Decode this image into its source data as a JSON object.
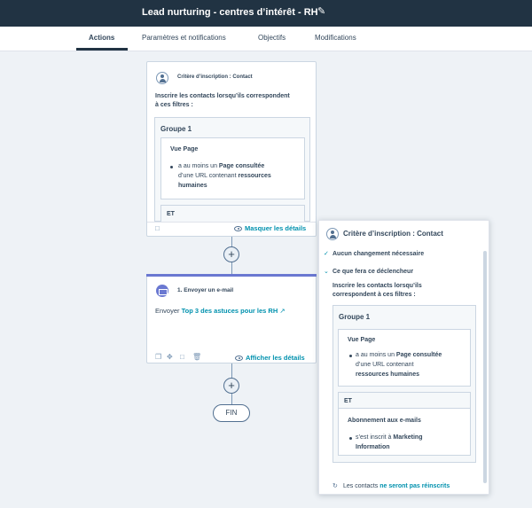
{
  "header": {
    "title": "Lead nurturing - centres d’intérêt - RH",
    "edit_icon": "pencil-icon"
  },
  "tabs": [
    {
      "label": "Actions",
      "active": true
    },
    {
      "label": "Paramètres et notifications",
      "active": false
    },
    {
      "label": "Objectifs",
      "active": false
    },
    {
      "label": "Modifications",
      "active": false
    }
  ],
  "trigger_card": {
    "title": "Critère d’inscription : Contact",
    "intro_line1": "Inscrire les contacts lorsqu’ils correspondent",
    "intro_line2": "à ces filtres :",
    "group_label": "Groupe 1",
    "filter_title": "Vue Page",
    "filter_l1_a": "a au moins un ",
    "filter_l1_b": "Page consultée",
    "filter_l2_a": "d’une URL contenant ",
    "filter_l2_b": "ressources",
    "filter_l3": "humaines",
    "and_label": "ET",
    "hide_details": "Masquer les détails"
  },
  "email_card": {
    "title": "1. Envoyer un e-mail",
    "send_prefix": "Envoyer ",
    "email_link": "Top 3 des astuces pour les RH",
    "show_details": "Afficher les détails"
  },
  "end_label": "FIN",
  "plus_label": "+",
  "details_panel": {
    "title": "Critère d’inscription : Contact",
    "check1": "Aucun changement nécessaire",
    "check2": "Ce que fera ce déclencheur",
    "intro_line1": "Inscrire les contacts lorsqu’ils",
    "intro_line2": "correspondent à ces filtres :",
    "group_label": "Groupe 1",
    "filter1_title": "Vue Page",
    "filter1_l1_a": "a au moins un ",
    "filter1_l1_b": "Page consultée",
    "filter1_l2": "d’une URL contenant",
    "filter1_l3": "ressources humaines",
    "and_label": "ET",
    "filter2_title": "Abonnement aux e-mails",
    "filter2_l1_a": "s’est inscrit à ",
    "filter2_l1_b": "Marketing",
    "filter2_l2": "Information",
    "footer_a": "Les contacts ",
    "footer_b": "ne seront pas réinscrits"
  },
  "colors": {
    "topbar": "#213343",
    "link": "#0091ae",
    "accent": "#6a78d1",
    "background": "#eef2f6"
  }
}
